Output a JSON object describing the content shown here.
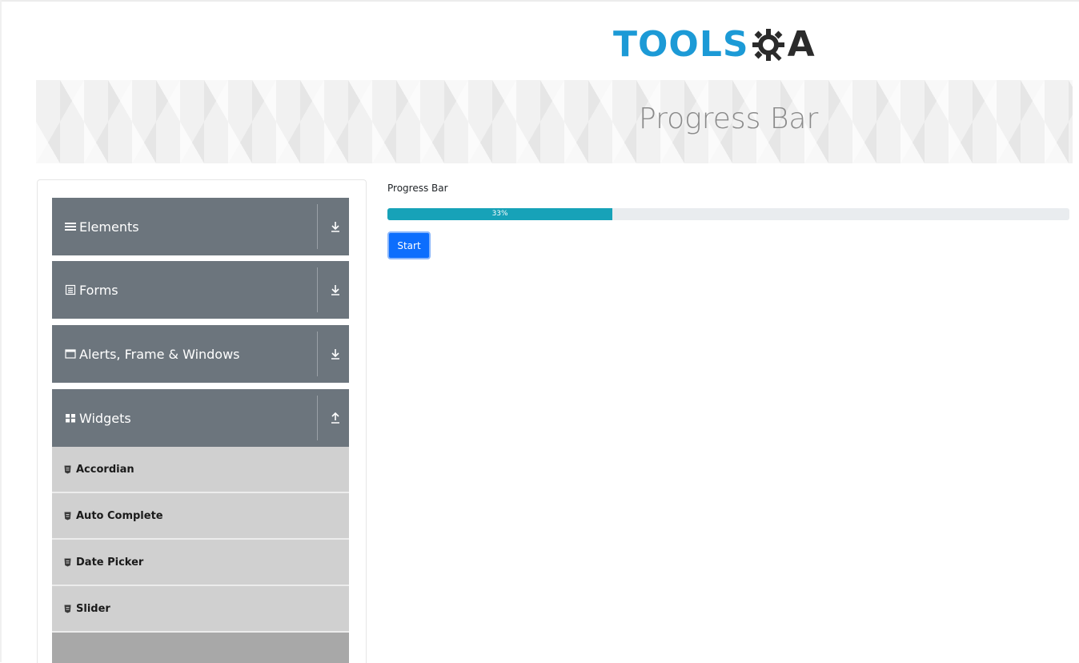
{
  "header": {
    "logo_text": "TOOLS",
    "logo_suffix": "A",
    "logo_icon": "gear-magnifier-icon",
    "brand_color": "#1c9ad6"
  },
  "banner": {
    "title": "Progress Bar"
  },
  "sidebar": {
    "groups": [
      {
        "label": "Elements",
        "icon": "hamburger-icon",
        "toggle": "download-arrow-icon"
      },
      {
        "label": "Forms",
        "icon": "form-icon",
        "toggle": "download-arrow-icon"
      },
      {
        "label": "Alerts, Frame & Windows",
        "icon": "window-icon",
        "toggle": "download-arrow-icon"
      },
      {
        "label": "Widgets",
        "icon": "grid-icon",
        "toggle": "upload-arrow-icon"
      }
    ],
    "widget_items": [
      {
        "label": "Accordian",
        "icon": "shield-icon"
      },
      {
        "label": "Auto Complete",
        "icon": "shield-icon"
      },
      {
        "label": "Date Picker",
        "icon": "shield-icon"
      },
      {
        "label": "Slider",
        "icon": "shield-icon"
      }
    ]
  },
  "main": {
    "progress_label": "Progress Bar",
    "progress_percent": 33,
    "progress_text": "33%",
    "progress_color": "#17a2b8",
    "start_label": "Start",
    "button_color": "#0d6efd"
  }
}
